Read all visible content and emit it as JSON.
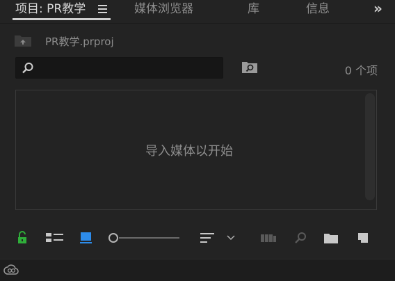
{
  "tabs": {
    "project": "项目: PR教学",
    "media_browser": "媒体浏览器",
    "library": "库",
    "info": "信息",
    "more": "»"
  },
  "project": {
    "file_name": "PR教学.prproj"
  },
  "search": {
    "value": "",
    "placeholder": ""
  },
  "item_count": "0 个项",
  "bin": {
    "empty_hint": "导入媒体以开始"
  },
  "icons": {
    "lock": "lock-open-icon",
    "list_view": "list-view-icon",
    "icon_view": "icon-view-icon",
    "sort": "sort-icon",
    "automate": "automate-sequence-icon",
    "find": "find-icon",
    "new_bin": "new-bin-icon",
    "new_item": "new-item-icon",
    "cc": "creative-cloud-icon"
  },
  "colors": {
    "lock_active": "#2fae3a",
    "icon_view_active": "#2d8ceb",
    "panel_bg": "#232323"
  },
  "zoom": {
    "level": 0
  }
}
